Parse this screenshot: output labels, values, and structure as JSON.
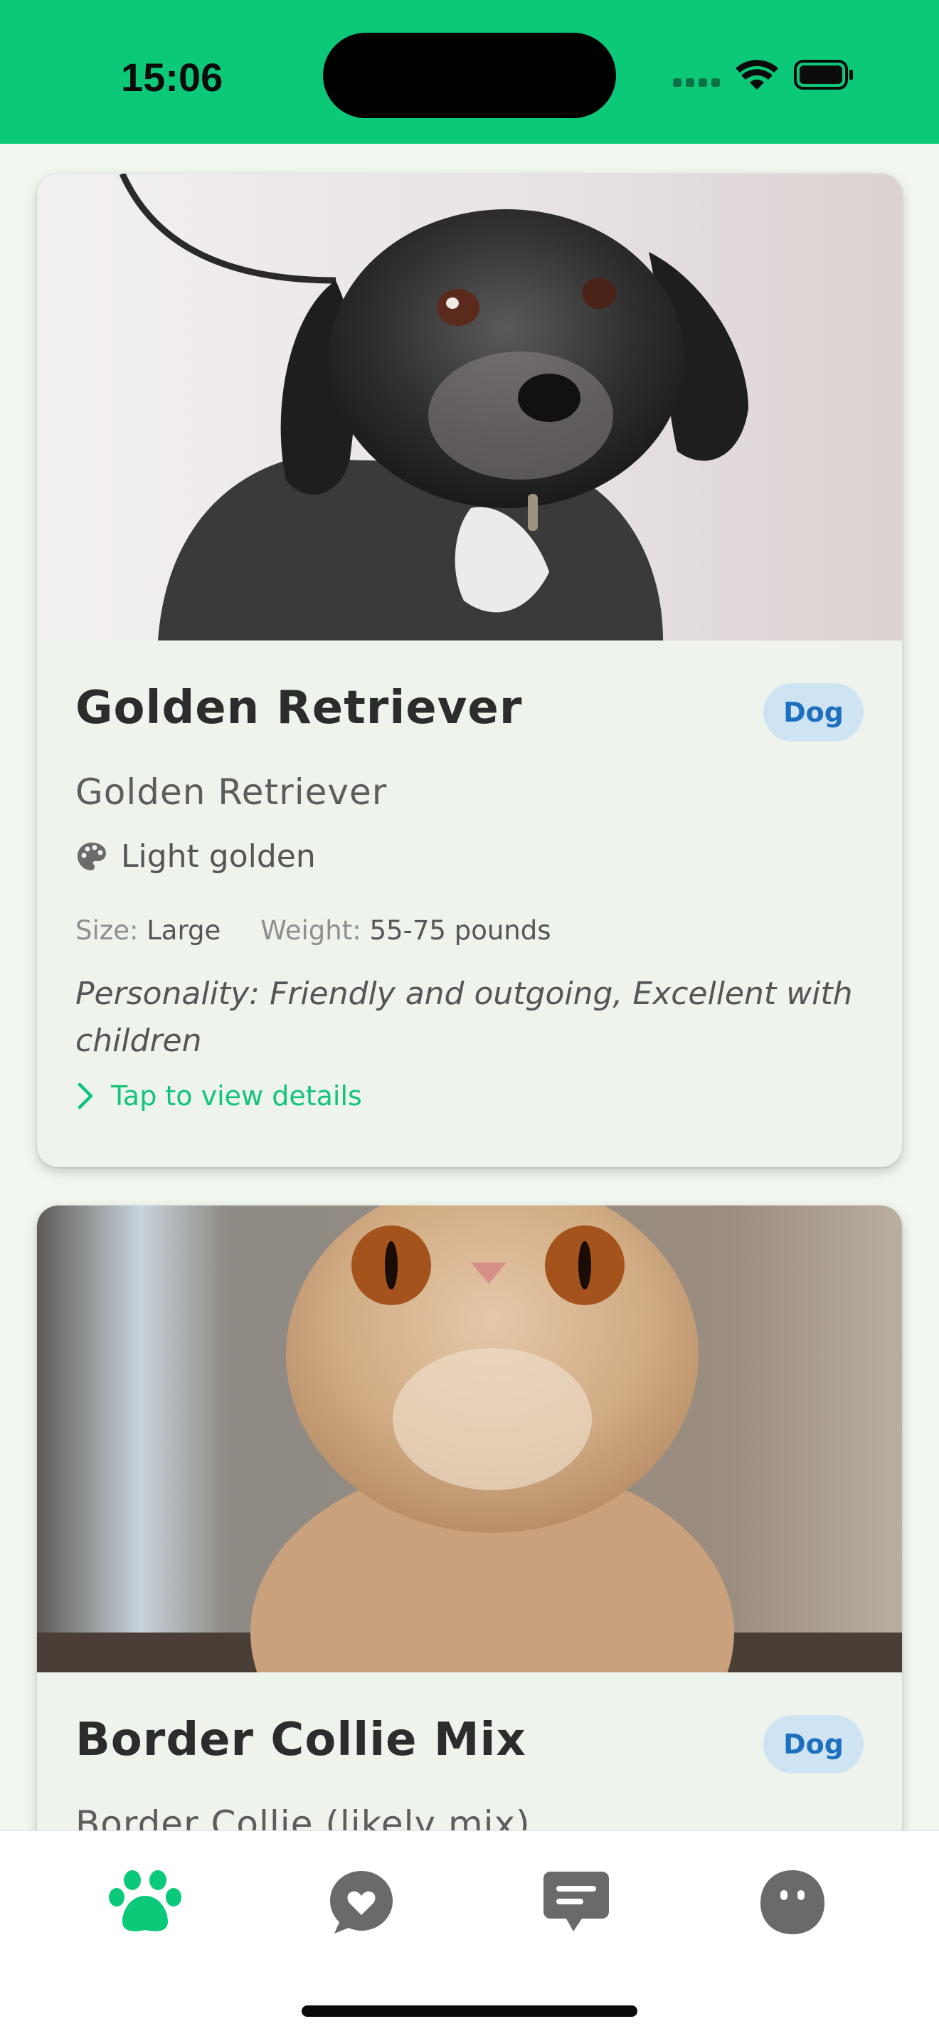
{
  "status_bar": {
    "time": "15:06",
    "icons": [
      "cellular-signal-icon",
      "wifi-icon",
      "battery-icon"
    ]
  },
  "theme": {
    "accent": "#0cc97a",
    "badge_bg": "#cfe4f3",
    "badge_text": "#1f6fbf",
    "card_bg": "#eef3ec",
    "tab_inactive": "#6a6a6a"
  },
  "pets": [
    {
      "name": "Golden Retriever",
      "type": "Dog",
      "breed": "Golden Retriever",
      "color": "Light golden",
      "size_label": "Size:",
      "size": "Large",
      "weight_label": "Weight:",
      "weight": "55-75 pounds",
      "personality": "Personality: Friendly and outgoing, Excellent with children",
      "cta": "Tap to view details",
      "photo": "black-dog-photo"
    },
    {
      "name": "Border Collie Mix",
      "type": "Dog",
      "breed": "Border Collie (likely mix)",
      "photo": "orange-cat-photo"
    }
  ],
  "tabs": [
    {
      "icon": "paw-icon",
      "active": true
    },
    {
      "icon": "heart-chat-icon",
      "active": false
    },
    {
      "icon": "message-icon",
      "active": false
    },
    {
      "icon": "profile-icon",
      "active": false
    }
  ]
}
